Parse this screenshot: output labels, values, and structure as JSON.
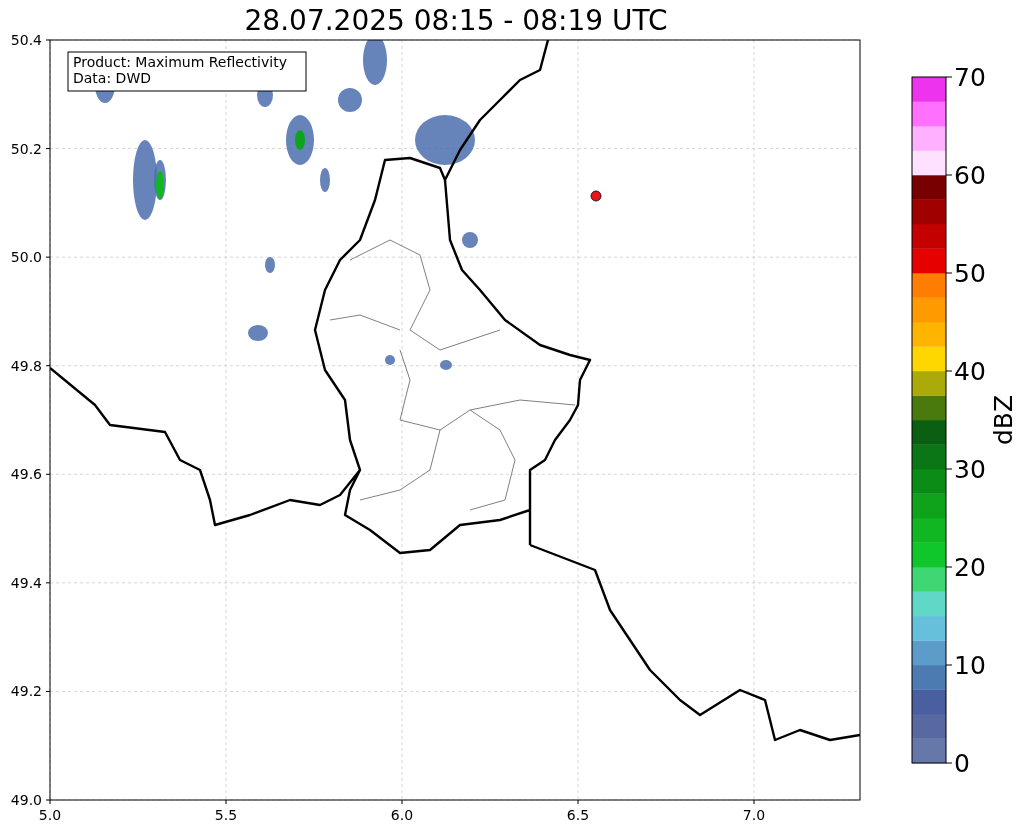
{
  "title": "28.07.2025 08:15 - 08:19 UTC",
  "annotation": [
    "Product: Maximum Reflectivity",
    "Data: DWD"
  ],
  "x_ticks": [
    "5.0",
    "5.5",
    "6.0",
    "6.5",
    "7.0"
  ],
  "y_ticks": [
    "50.4",
    "50.2",
    "50.0",
    "49.8",
    "49.6",
    "49.4",
    "49.2",
    "49.0"
  ],
  "colorbar": {
    "label": "dBZ",
    "ticks": [
      "70",
      "60",
      "50",
      "40",
      "30",
      "20",
      "10",
      "0"
    ],
    "bands": [
      {
        "color": "#6677aa"
      },
      {
        "color": "#5869a2"
      },
      {
        "color": "#4a5f9f"
      },
      {
        "color": "#4b7bb0"
      },
      {
        "color": "#5b9dc8"
      },
      {
        "color": "#66c0dc"
      },
      {
        "color": "#60d8c8"
      },
      {
        "color": "#3ed774"
      },
      {
        "color": "#10c72b"
      },
      {
        "color": "#10b722"
      },
      {
        "color": "#0ea31b"
      },
      {
        "color": "#0b8c17"
      },
      {
        "color": "#0b7616"
      },
      {
        "color": "#0a5f12"
      },
      {
        "color": "#4a7a0e"
      },
      {
        "color": "#aaaa0a"
      },
      {
        "color": "#ffd700"
      },
      {
        "color": "#ffb400"
      },
      {
        "color": "#ff9a00"
      },
      {
        "color": "#ff7d00"
      },
      {
        "color": "#e60000"
      },
      {
        "color": "#c40000"
      },
      {
        "color": "#a00000"
      },
      {
        "color": "#780000"
      },
      {
        "color": "#ffe0ff"
      },
      {
        "color": "#ffb0ff"
      },
      {
        "color": "#ff70ff"
      },
      {
        "color": "#ee33ee"
      }
    ]
  }
}
